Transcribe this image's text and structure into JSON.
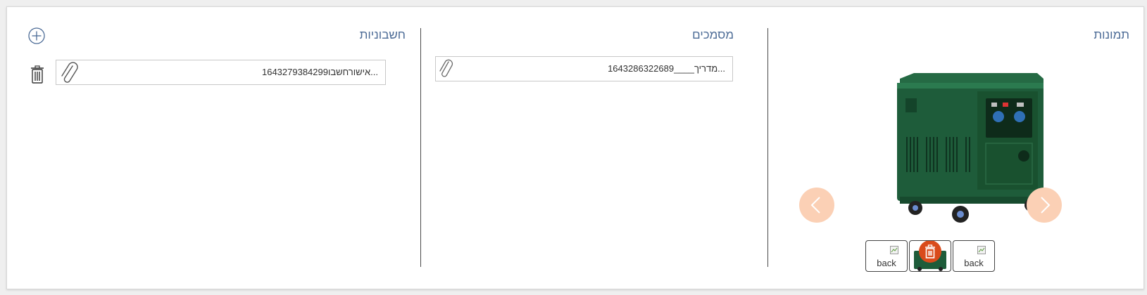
{
  "sections": {
    "images": {
      "title": "תמונות"
    },
    "documents": {
      "title": "מסמכים",
      "file_name": "1643286322689____מדריך..."
    },
    "invoices": {
      "title": "חשבוניות",
      "file_name": "1643279384299אישורחשבו..."
    }
  },
  "thumbnails": [
    {
      "label": "back"
    },
    {
      "label": ""
    },
    {
      "label": "back"
    }
  ],
  "colors": {
    "title": "#4c6b96",
    "nav_circle": "#fbd0b5",
    "delete_badge": "#d94b1b",
    "generator_body": "#1e5c3a"
  },
  "icons": {
    "add": "plus-circle-icon",
    "trash": "trash-icon",
    "attach": "paperclip-icon",
    "prev": "chevron-left-icon",
    "next": "chevron-right-icon"
  }
}
